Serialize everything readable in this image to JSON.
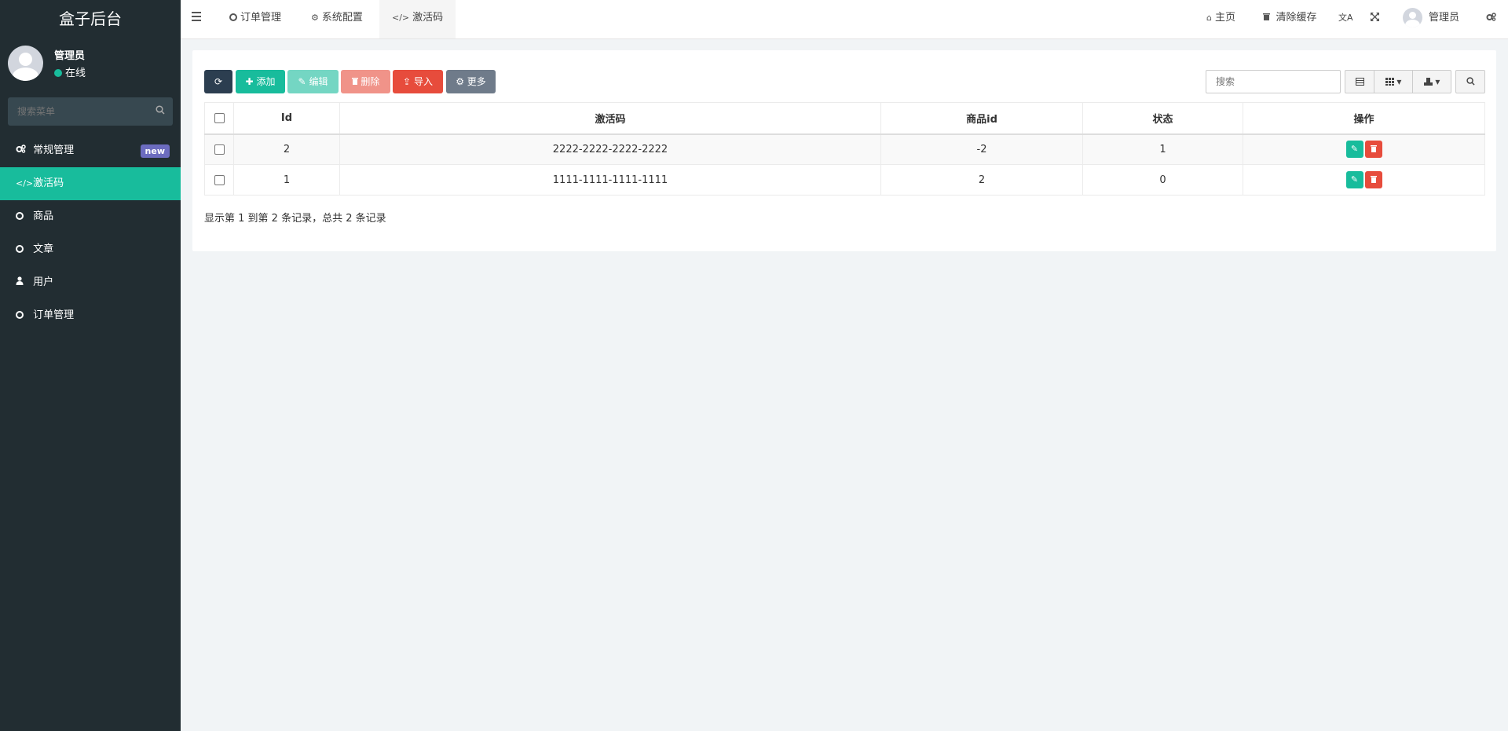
{
  "sidebar": {
    "brand": "盒子后台",
    "user": {
      "name": "管理员",
      "status": "在线"
    },
    "search_placeholder": "搜索菜单",
    "items": [
      {
        "label": "常规管理",
        "icon": "cogs-icon",
        "badge": "new",
        "active": false
      },
      {
        "label": "激活码",
        "icon": "code-icon",
        "active": true
      },
      {
        "label": "商品",
        "icon": "circle-icon",
        "active": false
      },
      {
        "label": "文章",
        "icon": "circle-icon",
        "active": false
      },
      {
        "label": "用户",
        "icon": "user-icon",
        "active": false
      },
      {
        "label": "订单管理",
        "icon": "circle-icon",
        "active": false
      }
    ]
  },
  "header": {
    "tabs": [
      {
        "label": "订单管理",
        "icon": "circle-icon",
        "active": false
      },
      {
        "label": "系统配置",
        "icon": "gear-icon",
        "active": false
      },
      {
        "label": "激活码",
        "icon": "code-icon",
        "active": true
      }
    ],
    "right": {
      "home": "主页",
      "clear_cache": "清除缓存",
      "admin": "管理员"
    }
  },
  "toolbar": {
    "add": "添加",
    "edit": "编辑",
    "delete": "删除",
    "import": "导入",
    "more": "更多",
    "search_placeholder": "搜索"
  },
  "table": {
    "columns": [
      "Id",
      "激活码",
      "商品id",
      "状态",
      "操作"
    ],
    "rows": [
      {
        "id": "2",
        "code": "2222-2222-2222-2222",
        "goods_id": "-2",
        "status": "1"
      },
      {
        "id": "1",
        "code": "1111-1111-1111-1111",
        "goods_id": "2",
        "status": "0"
      }
    ],
    "summary": "显示第 1 到第 2 条记录，总共 2 条记录"
  },
  "colors": {
    "sidebar_bg": "#222d32",
    "accent": "#18bc9c",
    "danger": "#e74c3c",
    "dark": "#2c3e50"
  }
}
